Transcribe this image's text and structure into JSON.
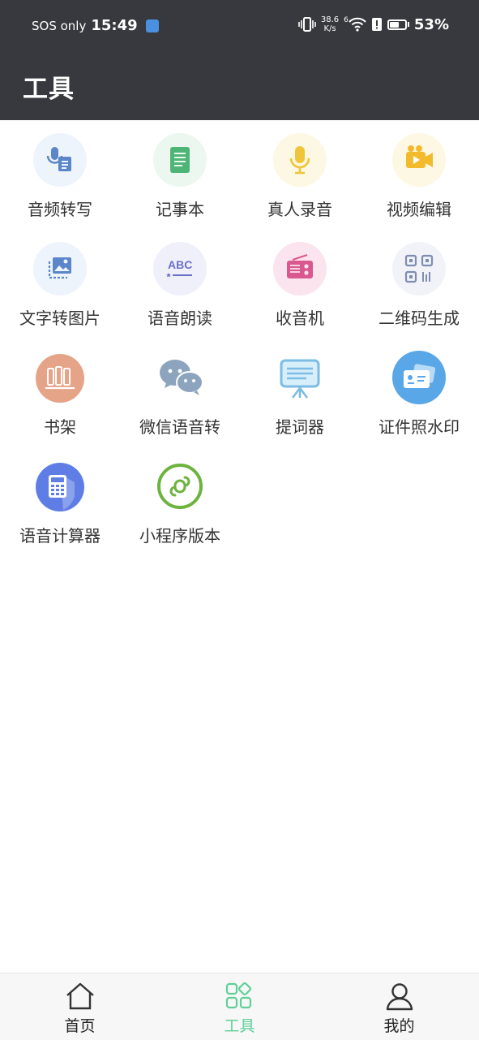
{
  "status_bar": {
    "carrier": "SOS only",
    "time": "15:49",
    "net_speed_value": "38.6",
    "net_speed_unit": "K/s",
    "signal_label": "6",
    "battery": "53%"
  },
  "header": {
    "title": "工具"
  },
  "tools": [
    {
      "label": "音频转写",
      "icon": "audio-transcribe-icon"
    },
    {
      "label": "记事本",
      "icon": "notepad-icon"
    },
    {
      "label": "真人录音",
      "icon": "microphone-icon"
    },
    {
      "label": "视频编辑",
      "icon": "video-camera-icon"
    },
    {
      "label": "文字转图片",
      "icon": "text-to-image-icon"
    },
    {
      "label": "语音朗读",
      "icon": "abc-read-icon"
    },
    {
      "label": "收音机",
      "icon": "radio-icon"
    },
    {
      "label": "二维码生成",
      "icon": "qr-code-icon"
    },
    {
      "label": "书架",
      "icon": "bookshelf-icon"
    },
    {
      "label": "微信语音转",
      "icon": "wechat-icon"
    },
    {
      "label": "提词器",
      "icon": "teleprompter-icon"
    },
    {
      "label": "证件照水印",
      "icon": "id-card-icon"
    },
    {
      "label": "语音计算器",
      "icon": "calculator-icon"
    },
    {
      "label": "小程序版本",
      "icon": "mini-program-icon"
    }
  ],
  "bottom_nav": [
    {
      "label": "首页",
      "icon": "home-icon",
      "active": false
    },
    {
      "label": "工具",
      "icon": "tools-grid-icon",
      "active": true
    },
    {
      "label": "我的",
      "icon": "profile-icon",
      "active": false
    }
  ],
  "colors": {
    "header_bg": "#38393e",
    "accent_active": "#5fcf97"
  }
}
